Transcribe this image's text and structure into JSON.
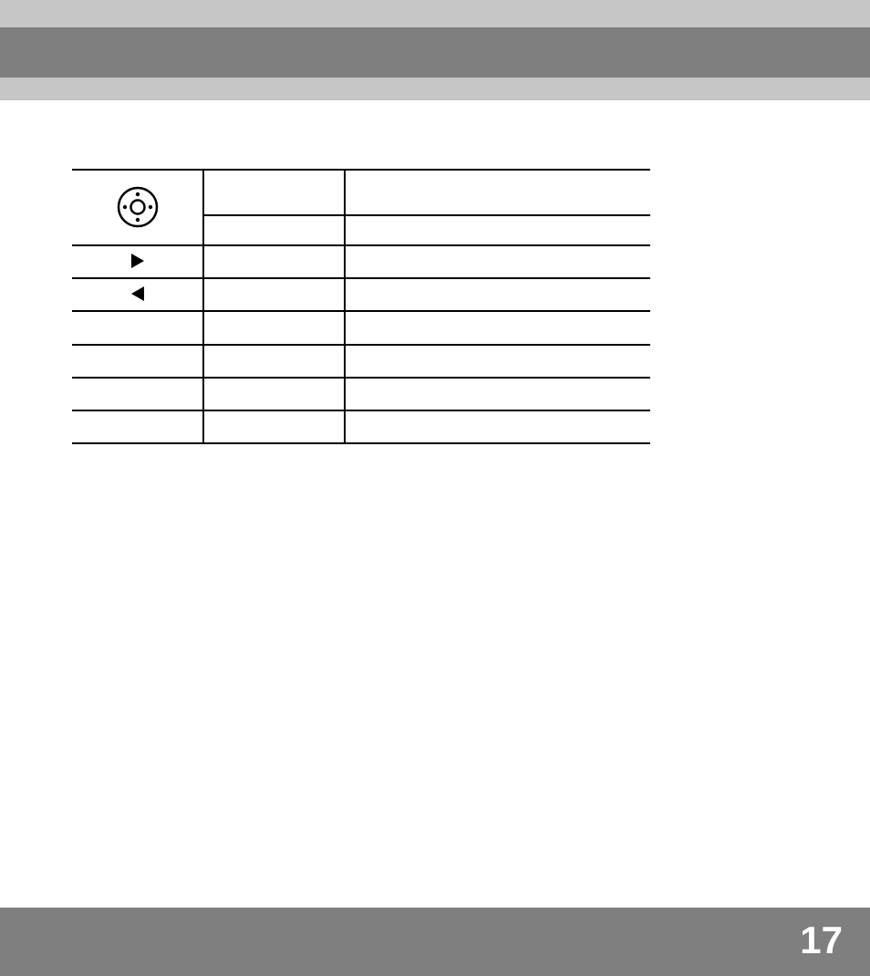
{
  "page_number": "17",
  "table": {
    "columns": 3,
    "rows": [
      {
        "icon": "selector-icon",
        "col2": "",
        "col3": "",
        "subrows": 2
      },
      {
        "icon": "triangle-right-icon",
        "col2": "",
        "col3": ""
      },
      {
        "icon": "triangle-left-icon",
        "col2": "",
        "col3": ""
      },
      {
        "icon": "",
        "col2": "",
        "col3": ""
      },
      {
        "icon": "",
        "col2": "",
        "col3": ""
      },
      {
        "icon": "",
        "col2": "",
        "col3": ""
      },
      {
        "icon": "",
        "col2": "",
        "col3": ""
      }
    ]
  },
  "colors": {
    "header_light": "#c6c6c6",
    "header_dark": "#7f7f7f",
    "footer": "#7f7f7f",
    "rule": "#000000",
    "page_number": "#ffffff"
  }
}
